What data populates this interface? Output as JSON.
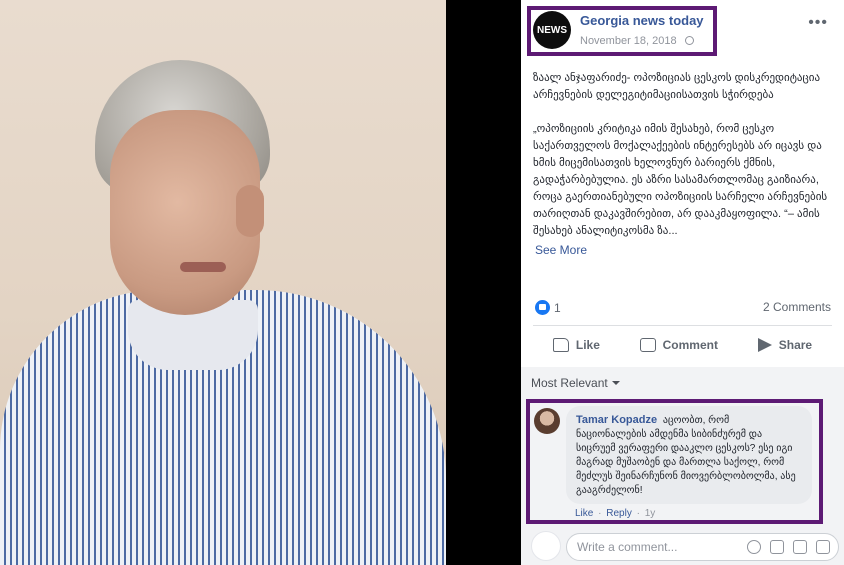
{
  "post": {
    "page_name": "Georgia news today",
    "avatar_text": "NEWS",
    "date": "November 18, 2018",
    "more": "•••",
    "text_paragraphs": [
      "ზაალ ანჯაფარიძე- ოპოზიციას ცესკოს დისკრედიტაცია არჩევნების დელეგიტიმაციისათვის სჭირდება",
      "„ოპოზიციის კრიტიკა იმის შესახებ, რომ ცესკო საქართველოს მოქალაქეების ინტერესებს არ იცავს და ხმის მიცემისათვის ხელოვნურ ბარიერს ქმნის, გადაჭარბებულია. ეს აზრი სასამართლომაც გაიზიარა, როცა გაერთიანებული ოპოზიციის სარჩელი არჩევნების თარიღთან დაკავშირებით, არ დააკმაყოფილა. “– ამის შესახებ ანალიტიკოსმა ზა..."
    ],
    "see_more": "See More",
    "reaction_count": "1",
    "comment_count": "2 Comments"
  },
  "actions": {
    "like": "Like",
    "comment": "Comment",
    "share": "Share"
  },
  "comments": {
    "sort_label": "Most Relevant",
    "items": [
      {
        "author": "Tamar Kopadze",
        "text": "აცოობთ, რომ ნაციონალების ამდენმა სიბინძურემ და სიცრუემ ვერაფერი დააკლო ცესკოს? ესე იგი მაგრად მუშაობენ და მართლა საქოლ, რომ მეძლუს შეინარჩუნონ მიოვერბლობოლმა, ასე გააგრძელონ!",
        "like": "Like",
        "reply": "Reply",
        "age": "1y"
      }
    ]
  },
  "composer": {
    "placeholder": "Write a comment..."
  },
  "colors": {
    "highlight_border": "#5d1a74",
    "link_blue": "#385898",
    "like_blue": "#1877f2"
  }
}
